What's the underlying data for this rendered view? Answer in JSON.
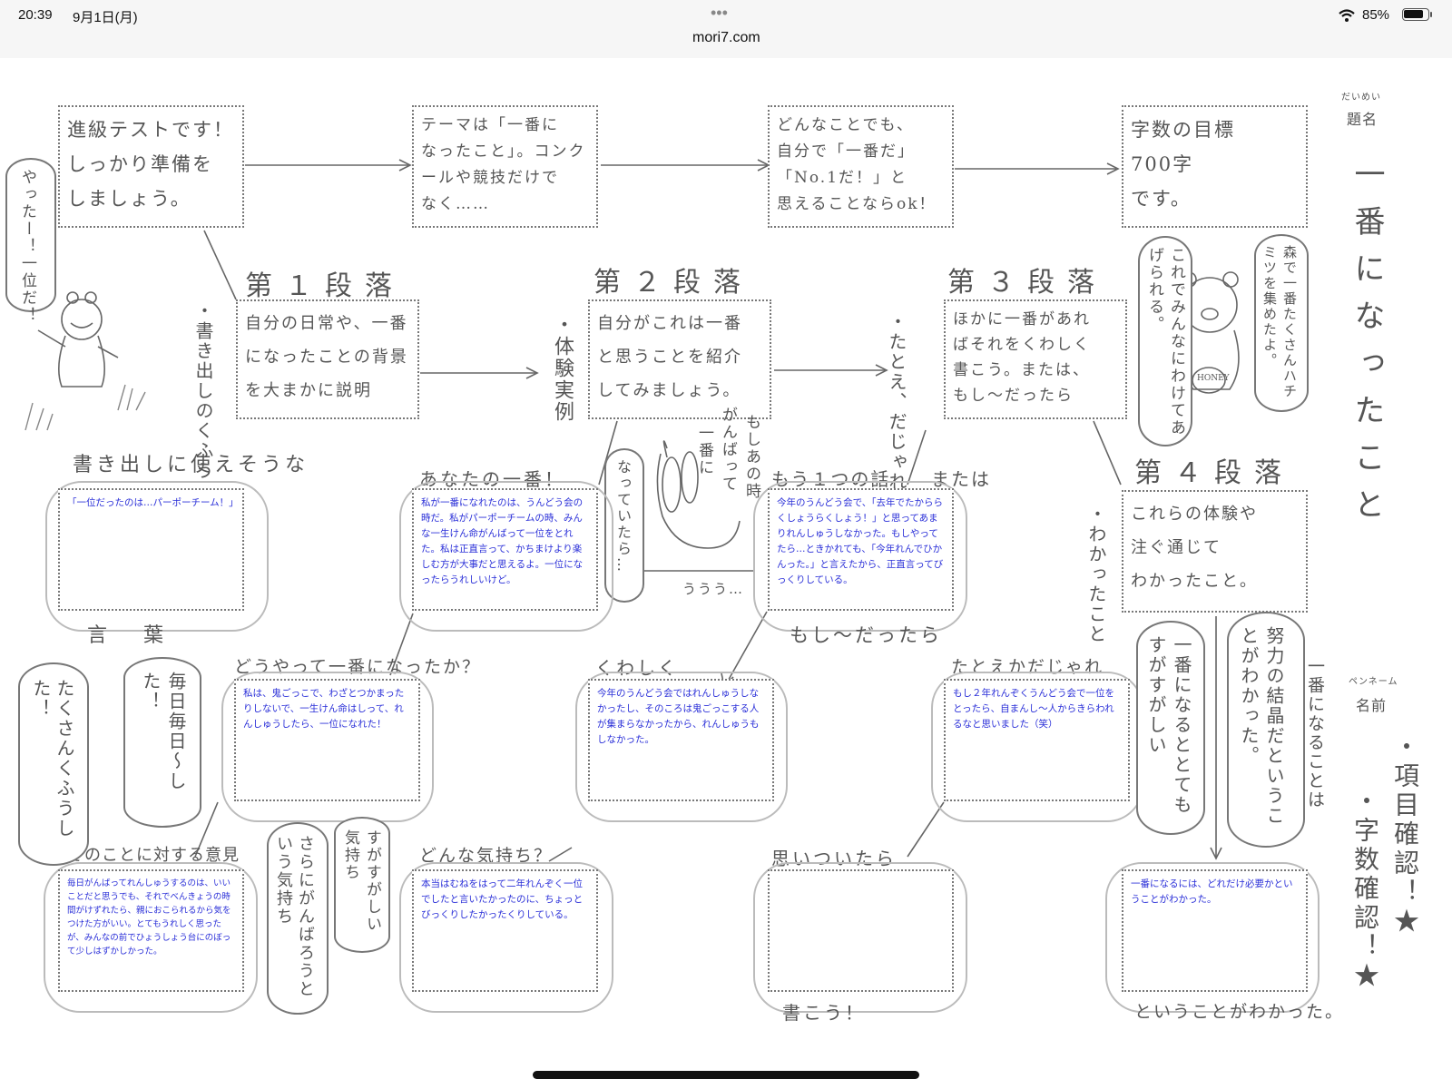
{
  "status_bar": {
    "time": "20:39",
    "date": "9月1日(月)",
    "more_dots": "•••",
    "url": "mori7.com",
    "battery_percent": "85%",
    "battery_level": 0.85
  },
  "worksheet": {
    "top_boxes": [
      "進級テストです！\nしっかり準備を\nしましょう。",
      "テーマは「一番に\nなったこと」。コンク\nールや競技だけで\nなく……",
      "どんなことでも、\n自分で「一番だ」\n「No.1だ！」と\n思えることならok！",
      "字数の目標\n700字\nです。"
    ],
    "frog_bubble": "やったー！一位だ！",
    "paragraphs": [
      {
        "heading": "第１段落",
        "box": "自分の日常や、一番\nになったことの背景\nを大まかに説明",
        "side_note": "・書き出しのくふう"
      },
      {
        "heading": "第２段落",
        "box": "自分がこれは一番\nと思うことを紹介\nしてみましょう。",
        "side_note": "・体験実例"
      },
      {
        "heading": "第３段落",
        "box": "ほかに一番があれ\nばそれをくわしく\n書こう。または、\nもし〜だったら",
        "side_note": "・たとえ、だじゃれ"
      },
      {
        "heading": "第４段落",
        "box": "これらの体験や\n注ぐ通じて\nわかったこと。",
        "side_note": "・わかったこと"
      }
    ],
    "bear_bubbles": [
      "これでみんなにわけてあげられる。",
      "森で一番たくさんハチミツを集めたよ。"
    ],
    "bear_pot_label": "HONEY",
    "rabbit_bubbles": [
      "もしあの時",
      "がんばって",
      "一番に",
      "なっていたら…"
    ],
    "rabbit_moan": "ううう…",
    "kaki_dashi": {
      "label_top": "書き出しに使えそうな",
      "label_bottom": "言葉",
      "answer": "「一位だったのは…パーポーチーム！」"
    },
    "anata_no_ichiban": {
      "label": "あなたの一番！",
      "answer": "私が一番になれたのは、うんどう会の時だ。私がパーポーチームの時、みんな一生けん命がんばって一位をとれた。私は正直言って、かちまけより楽しむ方が大事だと思えるよ。一位になったらうれしいけど。"
    },
    "mou_hitotsu": {
      "label": "もう１つの話",
      "label_or": "または",
      "label_bottom": "もし〜だったら",
      "answer": "今年のうんどう会で、「去年でたかららくしょうらくしょう！」と思ってあまりれんしゅうしなかった。もしやってたら…ときかれても、「今年れんでひかんった。」と言えたから、正直言ってびっくりしている。"
    },
    "douyatte": {
      "label": "どうやって一番になったか？",
      "answer": "私は、鬼ごっこで、わざとつかまったりしないで、一生けん命はしって、れんしゅうしたら、一位になれた！"
    },
    "kuwashiku": {
      "label": "くわしく",
      "answer": "今年のうんどう会ではれんしゅうしなかったし、そのころは鬼ごっこする人が集まらなかったから、れんしゅうもしなかった。"
    },
    "tatoeka": {
      "label": "たとえかだじゃれ",
      "answer": "もし２年れんぞくうんどう会で一位をとったら、自まんし〜人からきらわれるなと思いました（笑）"
    },
    "iken": {
      "label": "そのことに対する意見",
      "answer": "毎日がんばってれんしゅうするのは、いいことだと思うでも、それでべんきょうの時間がけずれたら、親におこられるから気をつけた方がいい。とてもうれしく思ったが、みんなの前でひょうしょう台にのぼって少しはずかしかった。"
    },
    "kimochi": {
      "label": "どんな気持ち？",
      "answer": "本当はむねをはって二年れんぞく一位でしたと言いたかったのに、ちょっとびっくりしたかったくりしている。"
    },
    "omoitsuitara": {
      "label": "思いついたら",
      "label_bottom": "書こう！",
      "answer": ""
    },
    "wakatta": {
      "label_bottom": "ということがわかった。",
      "answer": "一番になるには、どれだけ必要かということがわかった。"
    },
    "left_bubbles": [
      "たくさんくふうした！",
      "毎日毎日〜した！"
    ],
    "middle_bubbles": [
      "さらにがんばろうという気持ち",
      "すがすがしい気持ち"
    ],
    "right_bubbles": [
      "一番になるととてもすがすがしい",
      "努力の結晶だということがわかった。",
      "一番になることは"
    ],
    "title_label": "題名",
    "title_furigana": "だいめい",
    "title": "一番になったこと",
    "name_label": "名前",
    "pen_name_label": "ペンネーム",
    "checklist": [
      "・項目確認！★",
      "・字数確認！★"
    ]
  }
}
